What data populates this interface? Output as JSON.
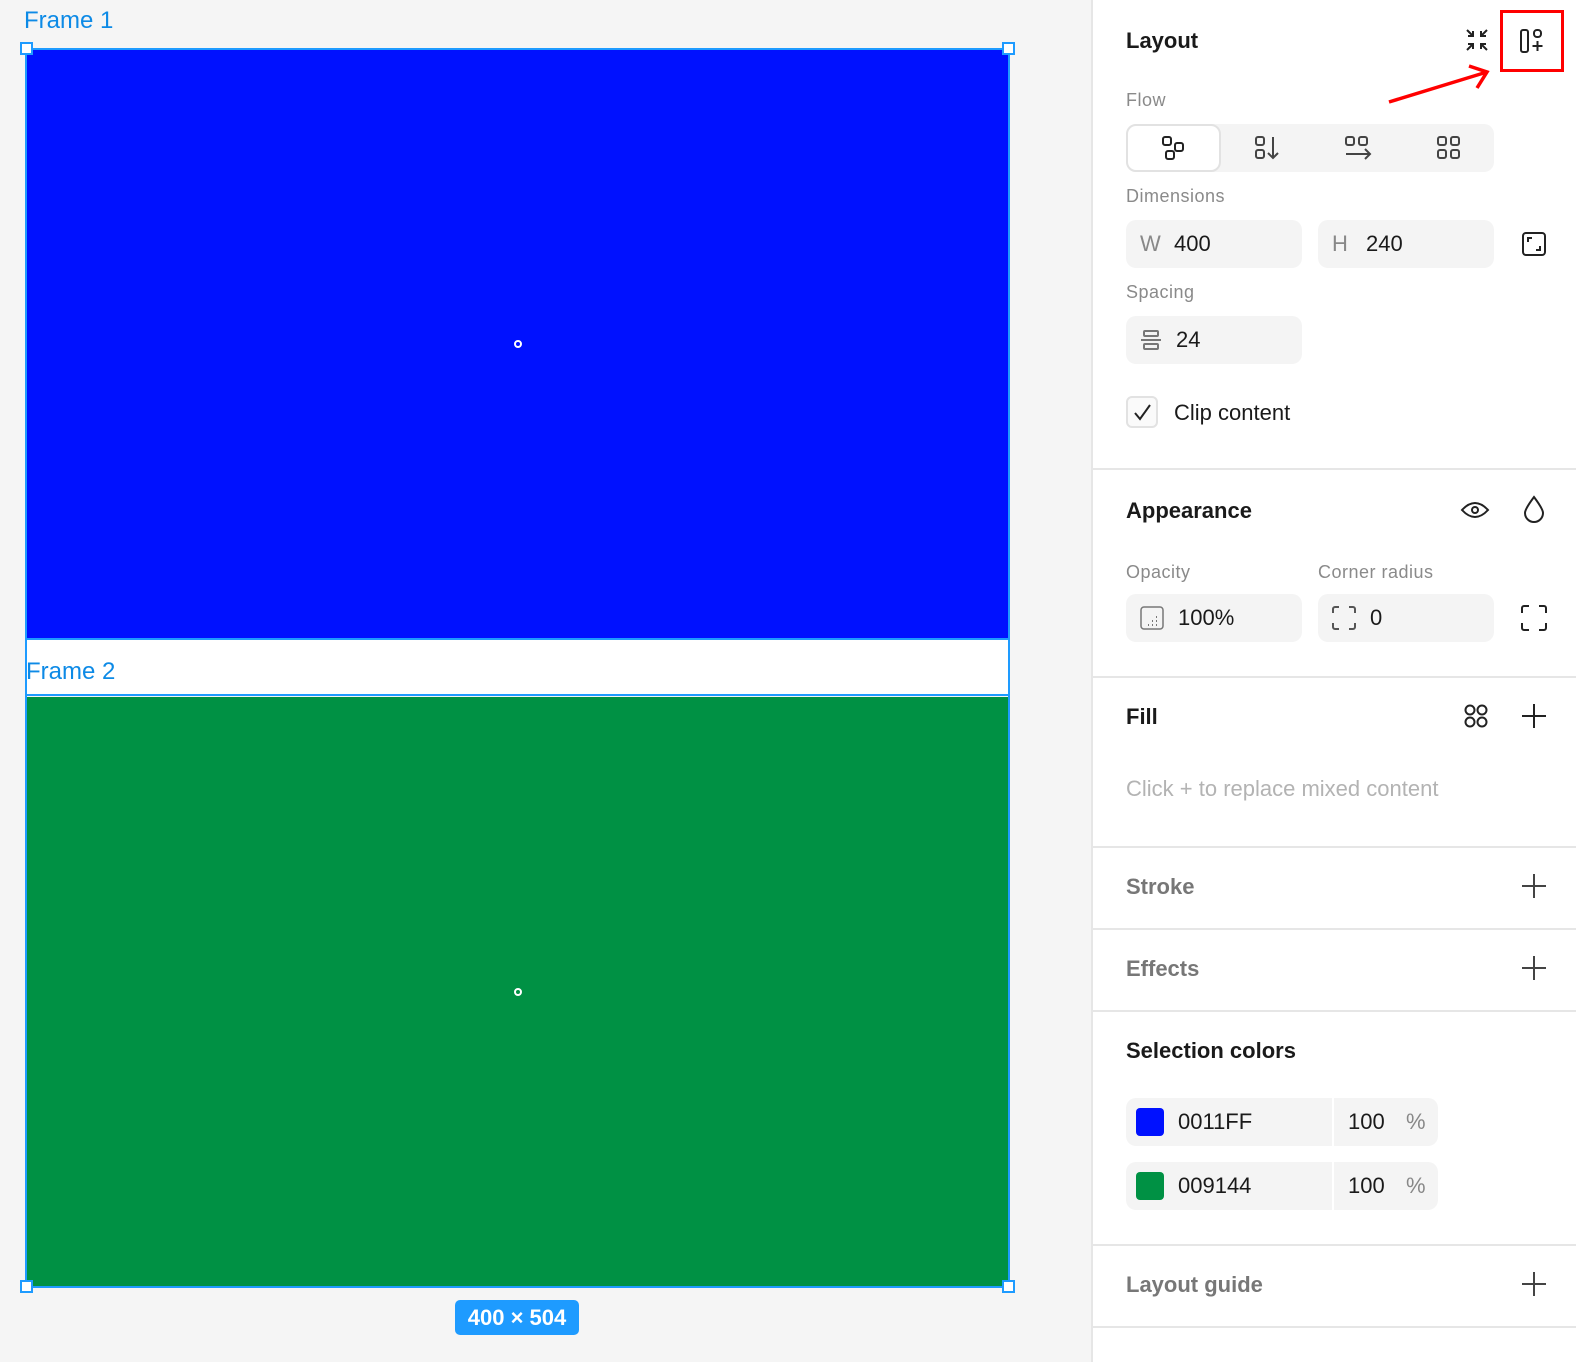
{
  "canvas": {
    "frames": [
      {
        "label": "Frame 1",
        "color": "#0011FF"
      },
      {
        "label": "Frame 2",
        "color": "#009144"
      }
    ],
    "size_badge": "400 × 504"
  },
  "panel": {
    "layout": {
      "title": "Layout",
      "flow_label": "Flow",
      "dimensions_label": "Dimensions",
      "w_prefix": "W",
      "w_value": "400",
      "h_prefix": "H",
      "h_value": "240",
      "spacing_label": "Spacing",
      "spacing_value": "24",
      "clip_label": "Clip content",
      "clip_checked": true
    },
    "appearance": {
      "title": "Appearance",
      "opacity_label": "Opacity",
      "opacity_value": "100%",
      "radius_label": "Corner radius",
      "radius_value": "0"
    },
    "fill": {
      "title": "Fill",
      "hint": "Click + to replace mixed content"
    },
    "stroke": {
      "title": "Stroke"
    },
    "effects": {
      "title": "Effects"
    },
    "selection_colors": {
      "title": "Selection colors",
      "items": [
        {
          "hex": "0011FF",
          "opacity": "100",
          "unit": "%",
          "color": "#0011FF"
        },
        {
          "hex": "009144",
          "opacity": "100",
          "unit": "%",
          "color": "#009144"
        }
      ]
    },
    "layout_guide": {
      "title": "Layout guide"
    }
  }
}
